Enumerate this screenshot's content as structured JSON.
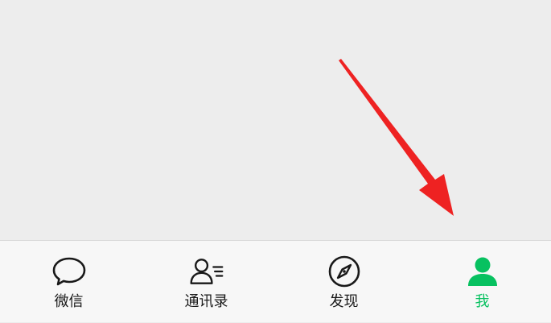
{
  "tab_bar": {
    "active_color": "#07c160",
    "inactive_color": "#191919",
    "tabs": [
      {
        "label": "微信",
        "icon": "chat-bubble-icon",
        "active": false
      },
      {
        "label": "通讯录",
        "icon": "contacts-icon",
        "active": false
      },
      {
        "label": "发现",
        "icon": "compass-icon",
        "active": false
      },
      {
        "label": "我",
        "icon": "person-icon",
        "active": true
      }
    ]
  },
  "annotation": {
    "type": "arrow",
    "color": "#ee2222",
    "points_to": "我"
  }
}
